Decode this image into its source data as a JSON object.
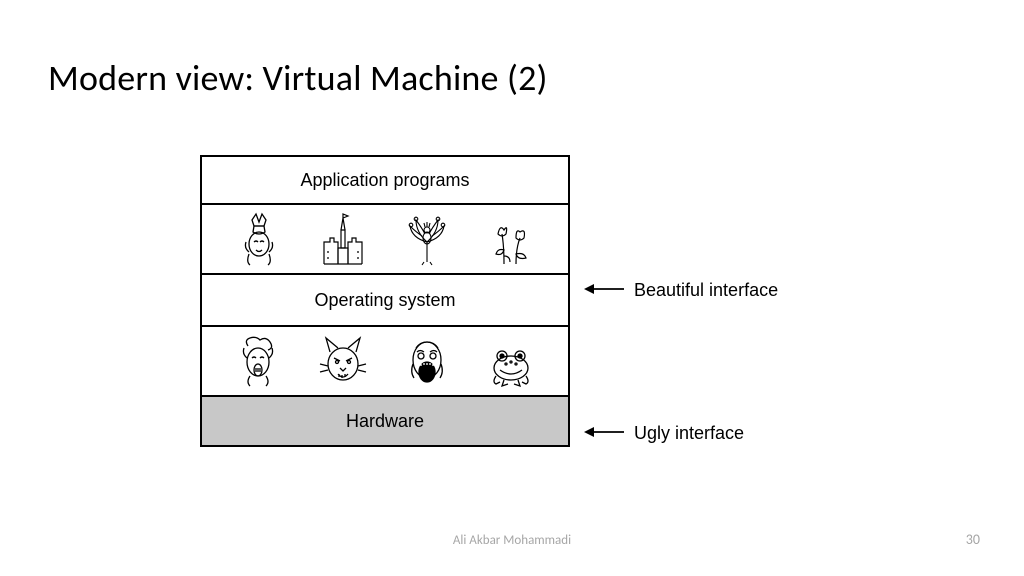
{
  "title": "Modern view: Virtual Machine (2)",
  "layers": {
    "apps": "Application programs",
    "os": "Operating system",
    "hw": "Hardware"
  },
  "beautiful_icons": [
    "crowned-queen-icon",
    "castle-icon",
    "peacock-icon",
    "flowers-icon"
  ],
  "ugly_icons": [
    "wild-man-icon",
    "angry-cat-icon",
    "screaming-face-icon",
    "toad-icon"
  ],
  "annotations": {
    "beautiful": "Beautiful interface",
    "ugly": "Ugly interface"
  },
  "footer": {
    "author": "Ali Akbar Mohammadi",
    "page": "30"
  }
}
